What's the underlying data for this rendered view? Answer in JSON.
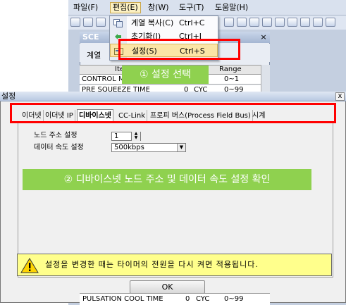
{
  "app": {
    "menu": [
      "파일(F)",
      "편집(E)",
      "창(W)",
      "도구(T)",
      "도움말(H)"
    ],
    "edit_menu_items": [
      {
        "label": "계열 복사(C)",
        "shortcut": "Ctrl+C"
      },
      {
        "label": "초기화(I)",
        "shortcut": "Ctrl+I"
      },
      {
        "label": "설정(S)",
        "shortcut": "Ctrl+S"
      }
    ],
    "inner_window": {
      "title": "SCE",
      "tab_label": "계열",
      "col_headers": [
        "Ite",
        "t",
        "Range"
      ],
      "rows": [
        {
          "name": "CONTROL M",
          "value": "",
          "unit": "",
          "range": "0~1"
        },
        {
          "name": "PRE SQUEEZE TIME",
          "value": "0",
          "unit": "CYC",
          "range": "0~99"
        }
      ],
      "bottom_row": {
        "name": "PULSATION COOL TIME",
        "value": "0",
        "unit": "CYC",
        "range": "0~99"
      }
    }
  },
  "annotations": {
    "step1": "① 설정 선택",
    "step2": "② 디바이스넷 노드 주소 및 데이터 속도 설정 확인"
  },
  "dialog": {
    "title": "설정",
    "close_glyph": "x",
    "tabs": [
      "이더넷",
      "이더넷 IP",
      "디바이스넷",
      "CC-Link",
      "프로피 버스(Process Field Bus)",
      "시계"
    ],
    "selected_tab": "디바이스넷",
    "fields": {
      "node_address_label": "노드 주소 설정",
      "node_address_value": "1",
      "data_rate_label": "데이터 속도 설정",
      "data_rate_value": "500kbps"
    },
    "warning": "설정을 변경한 때는 타이머의 전원을 다시 켜면 적용됩니다.",
    "ok_label": "OK"
  },
  "colors": {
    "highlight_red": "#ff0000",
    "callout_green": "#8fd14f",
    "warning_yellow": "#ffff8c"
  }
}
